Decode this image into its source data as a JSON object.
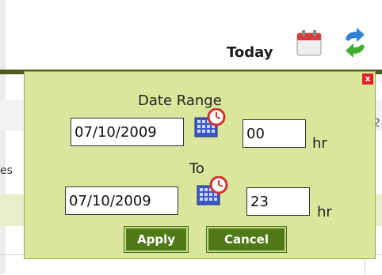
{
  "toolbar": {
    "today_label": "Today",
    "calendar_icon": "calendar-icon",
    "refresh_icon": "refresh-icon"
  },
  "background_fragments": {
    "left_text": "es",
    "right_text": "2"
  },
  "popup": {
    "close_label": "x",
    "date_range_label": "Date Range",
    "to_label": "To",
    "start_date": "07/10/2009",
    "start_hour": "00",
    "end_date": "07/10/2009",
    "end_hour": "23",
    "hour_unit": "hr",
    "apply_label": "Apply",
    "cancel_label": "Cancel",
    "date_picker_icon": "calendar-clock-icon"
  },
  "colors": {
    "popup_background": "#d8e79c",
    "button_background": "#4f7a17",
    "close_button": "#e52020",
    "header_rule": "#4f5a1f"
  }
}
